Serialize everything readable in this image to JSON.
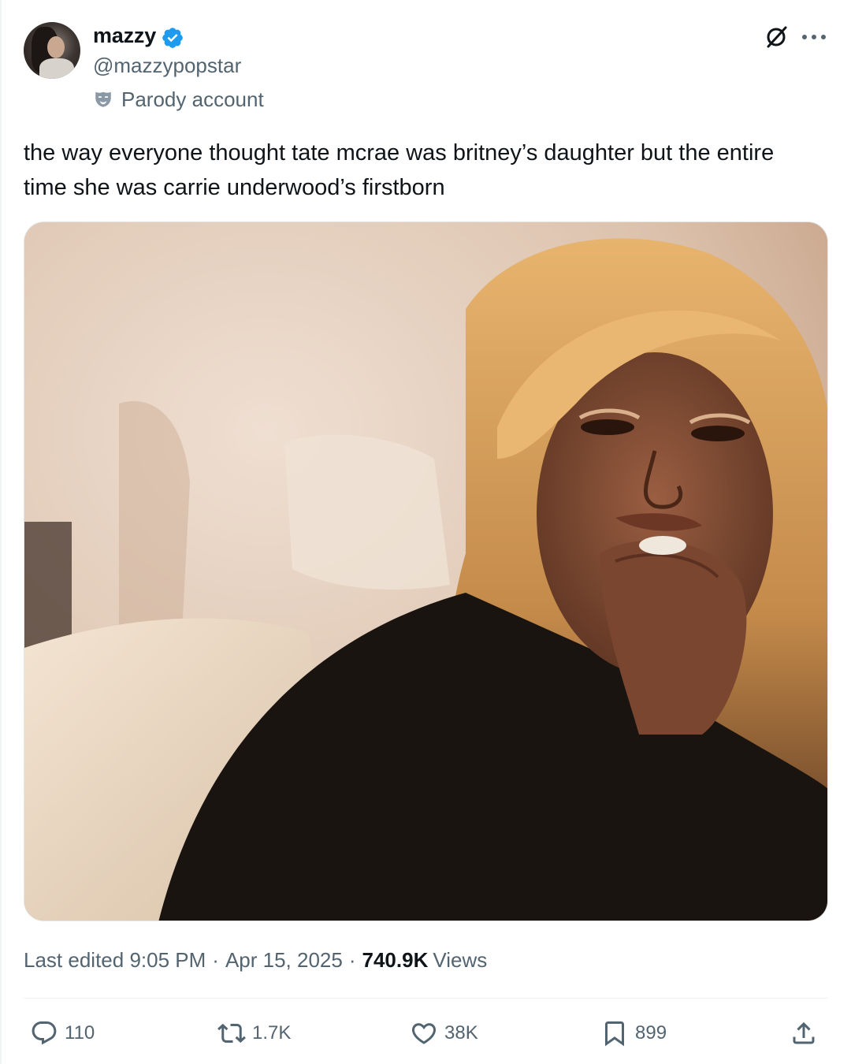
{
  "author": {
    "display_name": "mazzy",
    "handle": "@mazzypopstar",
    "label": "Parody account",
    "verified_color": "#1d9bf0"
  },
  "tweet": {
    "text": "the way everyone thought tate mcrae was britney’s daughter but the entire time she was carrie underwood’s firstborn",
    "media": "crying-woman-meme-photo"
  },
  "meta": {
    "edited_prefix": "Last edited",
    "time": "9:05 PM",
    "separator": "·",
    "date": "Apr 15, 2025",
    "views_count": "740.9K",
    "views_label": "Views"
  },
  "actions": {
    "replies": "110",
    "reposts": "1.7K",
    "likes": "38K",
    "bookmarks": "899"
  },
  "icons": {
    "verified": "verified-badge-icon",
    "parody": "mask-icon",
    "grok": "grok-icon",
    "more": "more-icon",
    "reply": "reply-icon",
    "repost": "repost-icon",
    "like": "heart-icon",
    "bookmark": "bookmark-icon",
    "share": "share-icon"
  }
}
